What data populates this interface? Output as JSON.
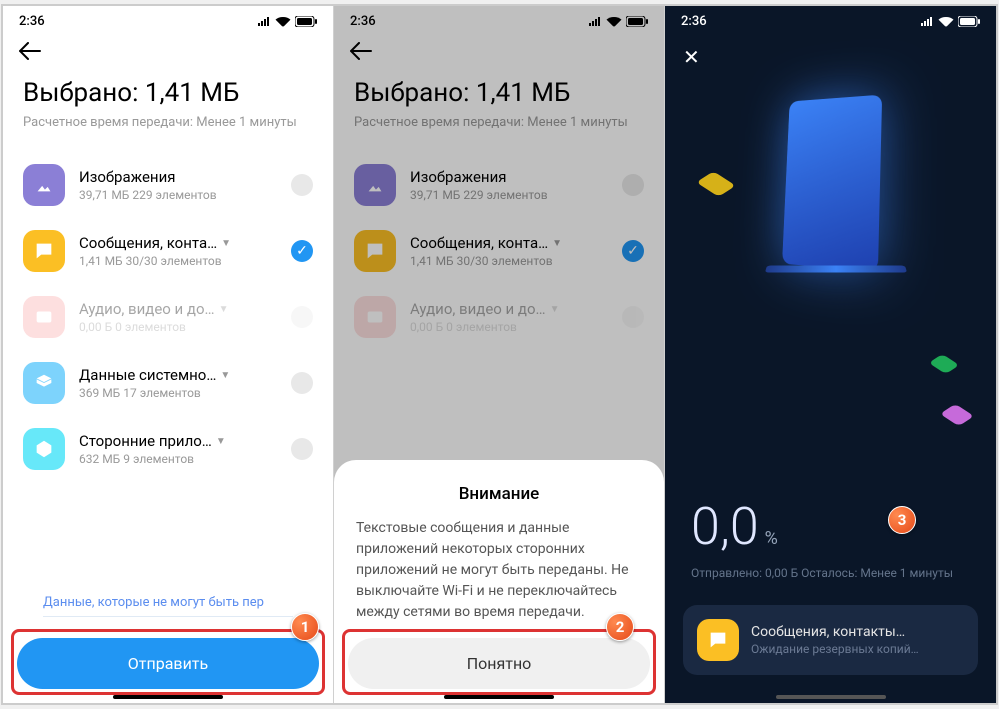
{
  "status": {
    "time": "2:36"
  },
  "screen1": {
    "title": "Выбрано: 1,41 МБ",
    "subtitle": "Расчетное время передачи: Менее 1 минуты",
    "items": {
      "images": {
        "label": "Изображения",
        "sub": "39,71 МБ  229 элементов"
      },
      "msg": {
        "label": "Сообщения, конта…",
        "sub": "1,41 МБ  30/30 элементов"
      },
      "media": {
        "label": "Аудио, видео и до…",
        "sub": "0,00 Б  0 элементов"
      },
      "system": {
        "label": "Данные системно…",
        "sub": "369 МБ  17 элементов"
      },
      "apps": {
        "label": "Сторонние прило…",
        "sub": "632 МБ  9 элементов"
      }
    },
    "link": "Данные, которые не могут быть пер",
    "button": "Отправить",
    "badge": "1"
  },
  "screen2": {
    "title": "Выбрано: 1,41 МБ",
    "subtitle": "Расчетное время передачи: Менее 1 минуты",
    "sheet": {
      "title": "Внимание",
      "body": "Текстовые сообщения и данные приложений некоторых сторонних приложений не могут быть переданы. Не выключайте Wi-Fi и не переключайтесь между сетями во время передачи.",
      "button": "Понятно"
    },
    "badge": "2"
  },
  "screen3": {
    "progress": "0,0",
    "pct": "%",
    "sub": "Отправлено: 0,00 Б  Осталось: Менее 1 минуты",
    "card": {
      "title": "Сообщения, контакты…",
      "sub": "Ожидание резервных копий…"
    },
    "badge": "3"
  }
}
